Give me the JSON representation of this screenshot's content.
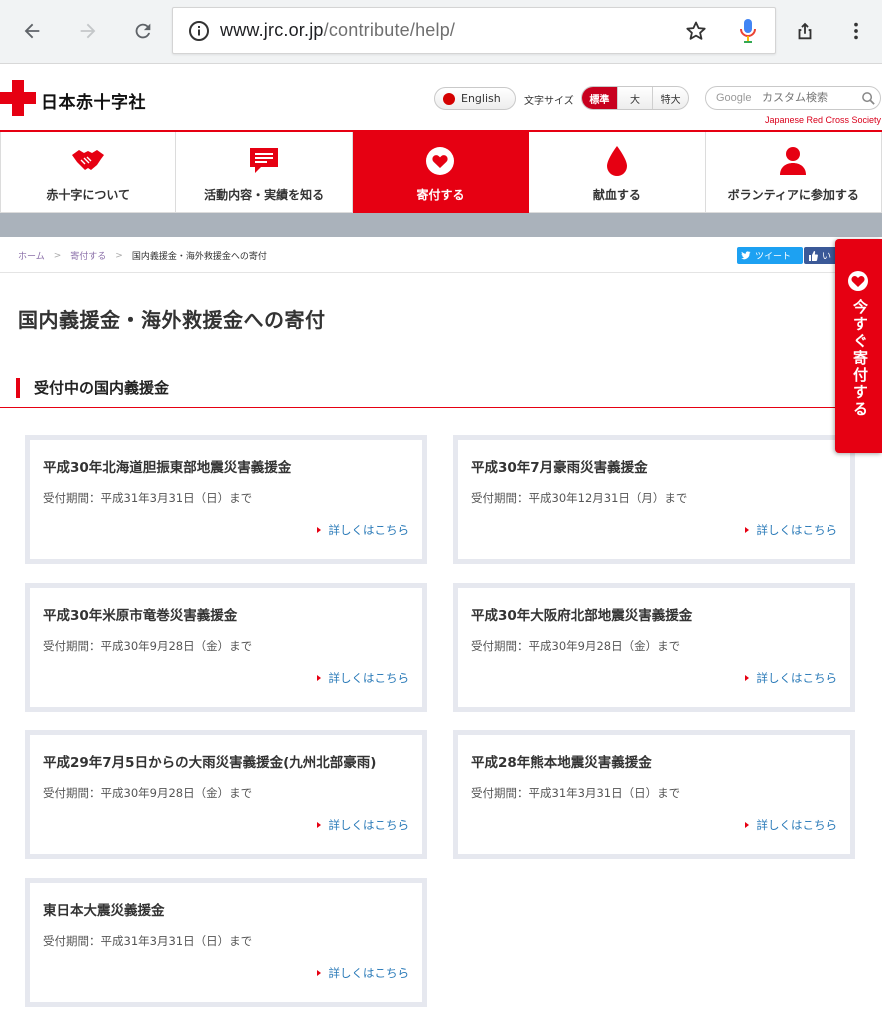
{
  "browser": {
    "url_host": "www.jrc.or.jp",
    "url_path": "/contribute/help/"
  },
  "header": {
    "logo_text": "日本赤十字社",
    "english_label": "English",
    "font_size_label": "文字サイズ",
    "font_sizes": [
      "標準",
      "大",
      "特大"
    ],
    "search_brand": "Google",
    "search_placeholder": "カスタム検索",
    "society_name": "Japanese Red Cross Society"
  },
  "nav": {
    "items": [
      {
        "label": "赤十字について",
        "icon": "handshake-icon"
      },
      {
        "label": "活動内容・実績を知る",
        "icon": "speech-bubble-icon"
      },
      {
        "label": "寄付する",
        "icon": "heart-icon",
        "active": true
      },
      {
        "label": "献血する",
        "icon": "blood-drop-icon"
      },
      {
        "label": "ボランティアに参加する",
        "icon": "person-icon"
      }
    ]
  },
  "breadcrumb": {
    "items": [
      "ホーム",
      "寄付する",
      "国内義援金・海外救援金への寄付"
    ]
  },
  "social": {
    "tweet": "ツイート",
    "like": "い"
  },
  "page": {
    "title": "国内義援金・海外救援金への寄付",
    "section_title": "受付中の国内義援金"
  },
  "cards": [
    {
      "title": "平成30年北海道胆振東部地震災害義援金",
      "period": "受付期間：平成31年3月31日（日）まで",
      "link": "詳しくはこちら"
    },
    {
      "title": "平成30年7月豪雨災害義援金",
      "period": "受付期間：平成30年12月31日（月）まで",
      "link": "詳しくはこちら"
    },
    {
      "title": "平成30年米原市竜巻災害義援金",
      "period": "受付期間：平成30年9月28日（金）まで",
      "link": "詳しくはこちら"
    },
    {
      "title": "平成30年大阪府北部地震災害義援金",
      "period": "受付期間：平成30年9月28日（金）まで",
      "link": "詳しくはこちら"
    },
    {
      "title": "平成29年7月5日からの大雨災害義援金(九州北部豪雨)",
      "period": "受付期間：平成30年9月28日（金）まで",
      "link": "詳しくはこちら"
    },
    {
      "title": "平成28年熊本地震災害義援金",
      "period": "受付期間：平成31年3月31日（日）まで",
      "link": "詳しくはこちら"
    },
    {
      "title": "東日本大震災義援金",
      "period": "受付期間：平成31年3月31日（日）まで",
      "link": "詳しくはこちら"
    }
  ],
  "float_donate": {
    "label": "今すぐ寄付する"
  },
  "colors": {
    "brand_red": "#e60012",
    "link_blue": "#2a7ab8",
    "card_border": "#e6e8ef"
  }
}
